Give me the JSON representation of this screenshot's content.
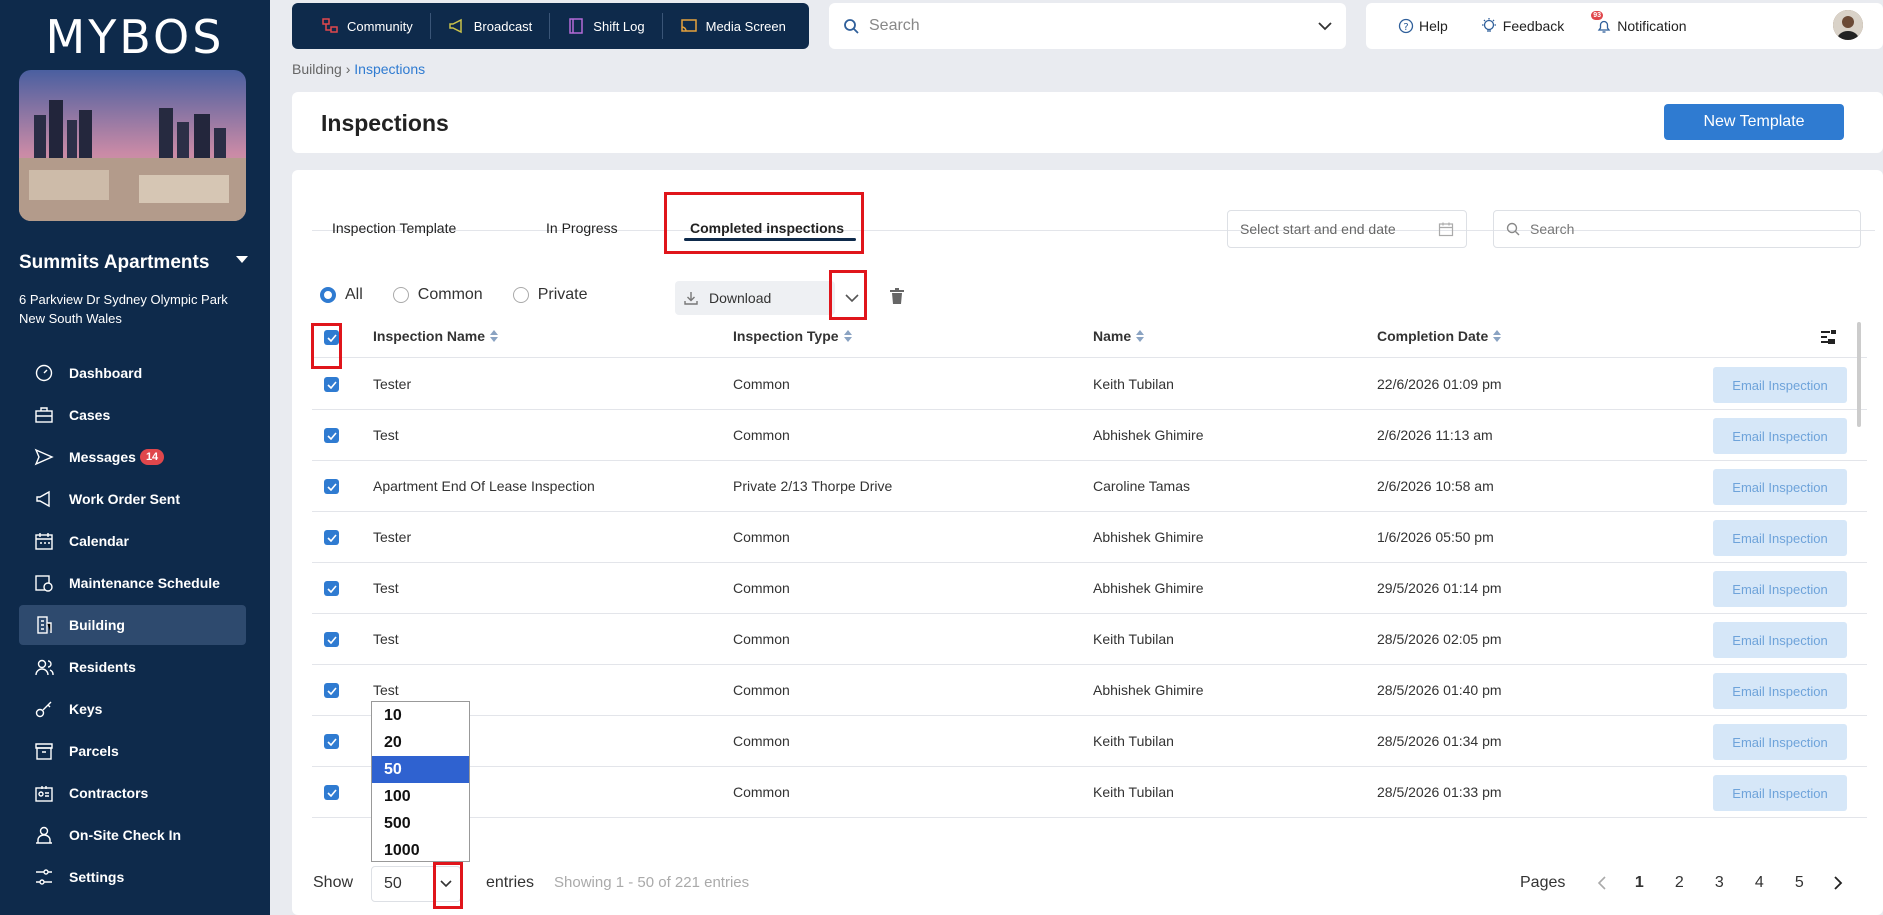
{
  "brand": "MYBOS",
  "site": {
    "name": "Summits Apartments",
    "address": "6 Parkview Dr Sydney Olympic Park New South Wales"
  },
  "sidebar": {
    "items": [
      {
        "label": "Dashboard",
        "icon": "dashboard-icon"
      },
      {
        "label": "Cases",
        "icon": "briefcase-icon"
      },
      {
        "label": "Messages",
        "icon": "send-icon",
        "badge": "14"
      },
      {
        "label": "Work Order Sent",
        "icon": "megaphone-icon"
      },
      {
        "label": "Calendar",
        "icon": "calendar-icon"
      },
      {
        "label": "Maintenance Schedule",
        "icon": "schedule-icon"
      },
      {
        "label": "Building",
        "icon": "building-icon",
        "active": true
      },
      {
        "label": "Residents",
        "icon": "residents-icon"
      },
      {
        "label": "Keys",
        "icon": "key-icon"
      },
      {
        "label": "Parcels",
        "icon": "parcel-icon"
      },
      {
        "label": "Contractors",
        "icon": "contractor-icon"
      },
      {
        "label": "On-Site Check In",
        "icon": "checkin-icon"
      },
      {
        "label": "Settings",
        "icon": "settings-icon"
      }
    ]
  },
  "topnav": {
    "community": "Community",
    "broadcast": "Broadcast",
    "shift_log": "Shift Log",
    "media_screen": "Media Screen"
  },
  "top_search": {
    "placeholder": "Search"
  },
  "top_right": {
    "help": "Help",
    "feedback": "Feedback",
    "notification": "Notification",
    "notification_count": "93"
  },
  "breadcrumb": {
    "root": "Building",
    "current": "Inspections"
  },
  "page": {
    "title": "Inspections",
    "new_template": "New Template"
  },
  "tabs": {
    "template": "Inspection Template",
    "in_progress": "In Progress",
    "completed": "Completed inspections"
  },
  "filters": {
    "date_placeholder": "Select start and end date",
    "search_placeholder": "Search",
    "all": "All",
    "common": "Common",
    "private": "Private",
    "download": "Download"
  },
  "table": {
    "headers": {
      "name": "Inspection Name",
      "type": "Inspection Type",
      "person": "Name",
      "date": "Completion Date"
    },
    "action_label": "Email Inspection",
    "rows": [
      {
        "name": "Tester",
        "type": "Common",
        "person": "Keith Tubilan",
        "date": "22/6/2026 01:09 pm"
      },
      {
        "name": "Test",
        "type": "Common",
        "person": "Abhishek Ghimire",
        "date": "2/6/2026 11:13 am"
      },
      {
        "name": "Apartment End Of Lease Inspection",
        "type": "Private 2/13 Thorpe Drive",
        "person": "Caroline Tamas",
        "date": "2/6/2026 10:58 am"
      },
      {
        "name": "Tester",
        "type": "Common",
        "person": "Abhishek Ghimire",
        "date": "1/6/2026 05:50 pm"
      },
      {
        "name": "Test",
        "type": "Common",
        "person": "Abhishek Ghimire",
        "date": "29/5/2026 01:14 pm"
      },
      {
        "name": "Test",
        "type": "Common",
        "person": "Keith Tubilan",
        "date": "28/5/2026 02:05 pm"
      },
      {
        "name": "Test",
        "type": "Common",
        "person": "Abhishek Ghimire",
        "date": "28/5/2026 01:40 pm"
      },
      {
        "name": "",
        "type": "Common",
        "person": "Keith Tubilan",
        "date": "28/5/2026 01:34 pm"
      },
      {
        "name": "",
        "type": "Common",
        "person": "Keith Tubilan",
        "date": "28/5/2026 01:33 pm"
      }
    ]
  },
  "page_size": {
    "options": [
      "10",
      "20",
      "50",
      "100",
      "500",
      "1000"
    ],
    "selected": "50"
  },
  "footer": {
    "show": "Show",
    "entries": "entries",
    "summary": "Showing 1 - 50 of 221 entries",
    "pages_label": "Pages",
    "pages": [
      "1",
      "2",
      "3",
      "4",
      "5"
    ],
    "current_page": "1"
  },
  "colors": {
    "sidebar": "#0e2a4b",
    "accent": "#2f7bd1",
    "highlight_box": "#e0151b",
    "badge": "#e0474c"
  }
}
